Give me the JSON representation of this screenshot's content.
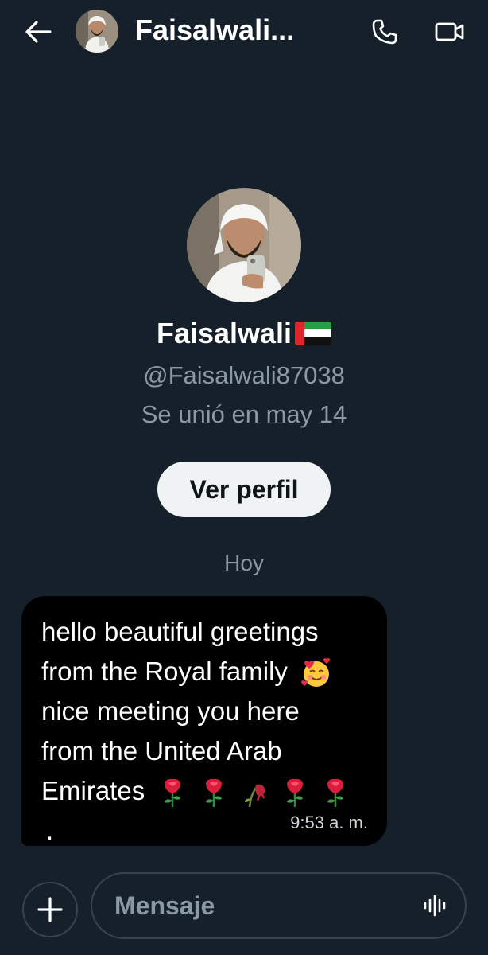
{
  "header": {
    "name": "Faisalwali...",
    "icons": {
      "back": "back-arrow-icon",
      "call": "phone-icon",
      "video": "video-call-icon"
    }
  },
  "profile": {
    "display_name": "Faisalwali",
    "flag": "uae-flag",
    "handle": "@Faisalwali87038",
    "joined": "Se unió en may 14",
    "button_label": "Ver perfil"
  },
  "conversation": {
    "date_separator": "Hoy",
    "messages": [
      {
        "line1": "hello beautiful greetings",
        "line2": "from the Royal family",
        "line3": "nice meeting you here",
        "line4": "from the United Arab",
        "line5": "Emirates",
        "line5_suffix": ".",
        "time": "9:53 a. m."
      }
    ]
  },
  "composer": {
    "placeholder": "Mensaje",
    "value": "",
    "icons": {
      "add": "plus-icon",
      "voice": "voice-wave-icon"
    }
  },
  "colors": {
    "background": "#15202b",
    "bubble": "#000000",
    "muted_text": "#8b98a5",
    "button_bg": "#eff3f4"
  }
}
